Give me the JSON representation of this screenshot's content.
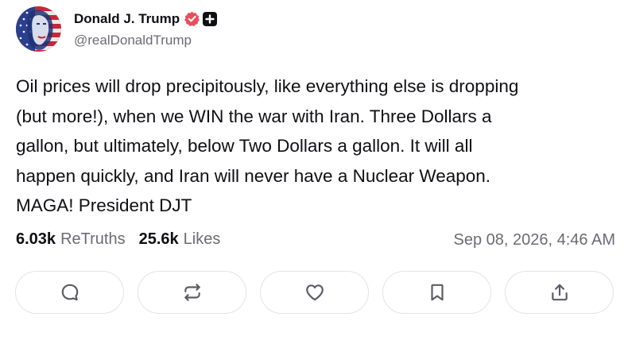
{
  "post": {
    "author": {
      "display_name": "Donald J. Trump",
      "handle": "@realDonaldTrump",
      "avatar": "avatar-image",
      "verified_badge_color": "#e84d5b"
    },
    "text": "Oil prices will drop precipitously, like everything else is dropping\n(but more!), when we WIN the war with Iran. Three Dollars a\ngallon, but ultimately, below Two Dollars a gallon. It will all\nhappen quickly, and Iran will never have a Nuclear Weapon.\nMAGA! President DJT",
    "stats": {
      "retruths_count": "6.03k",
      "retruths_label": "ReTruths",
      "likes_count": "25.6k",
      "likes_label": "Likes"
    },
    "timestamp": "Sep 08, 2026, 4:46 AM",
    "actions": [
      {
        "icon": "reply-icon"
      },
      {
        "icon": "retruth-icon"
      },
      {
        "icon": "like-icon"
      },
      {
        "icon": "bookmark-icon"
      },
      {
        "icon": "share-icon"
      }
    ]
  },
  "colors": {
    "text": "#0f0f14",
    "muted": "#6b6b76",
    "icon": "#5b5b68",
    "border": "#e4e4e9"
  }
}
